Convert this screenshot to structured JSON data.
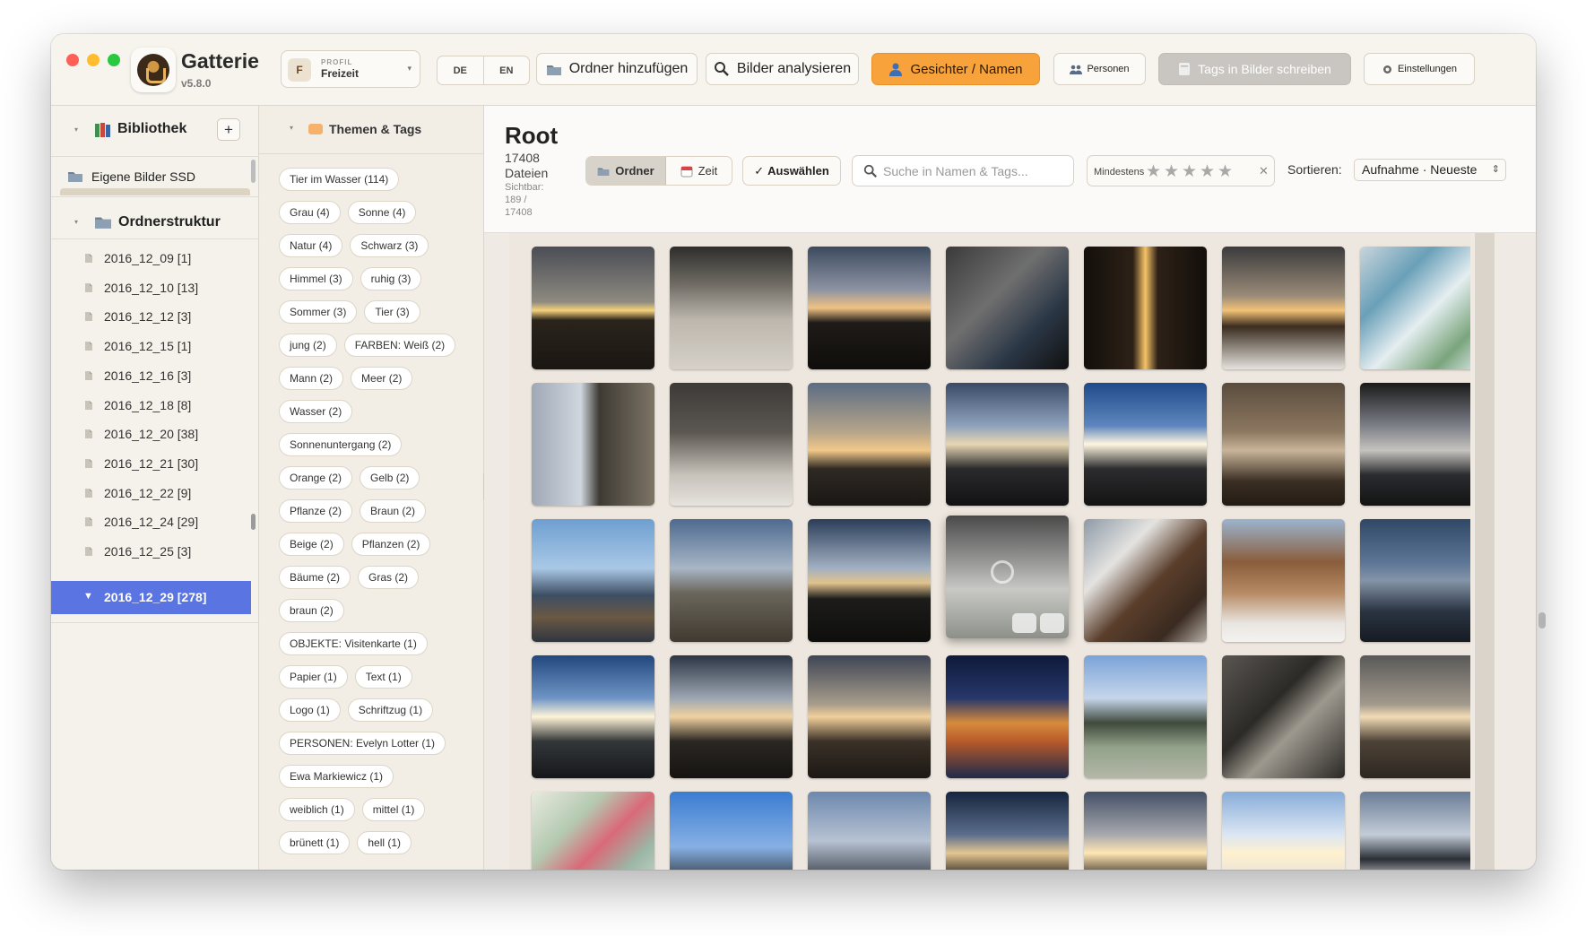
{
  "app": {
    "name": "Gatterie",
    "version": "v5.8.0"
  },
  "profile": {
    "label": "PROFIL",
    "value": "Freizeit",
    "initial": "F"
  },
  "languages": [
    "DE",
    "EN"
  ],
  "toolbar": {
    "add_folder": "Ordner hinzufügen",
    "analyze": "Bilder analysieren",
    "faces": "Gesichter / Namen",
    "persons": "Personen",
    "write_tags": "Tags in Bilder schreiben",
    "settings": "Einstellungen"
  },
  "sidebar": {
    "library_title": "Bibliothek",
    "add_label": "+",
    "library_item": "Eigene Bilder SSD",
    "structure_title": "Ordnerstruktur",
    "folders": [
      "2016_12_09 [1]",
      "2016_12_10 [13]",
      "2016_12_12 [3]",
      "2016_12_15 [1]",
      "2016_12_16 [3]",
      "2016_12_18 [8]",
      "2016_12_20 [38]",
      "2016_12_21 [30]",
      "2016_12_22 [9]",
      "2016_12_24 [29]",
      "2016_12_25 [3]"
    ],
    "selected_folder": "2016_12_29 [278]"
  },
  "tags_panel": {
    "title": "Themen & Tags",
    "tags": [
      "Tier im Wasser (114)",
      "Grau (4)",
      "Sonne (4)",
      "Natur (4)",
      "Schwarz (3)",
      "Himmel (3)",
      "ruhig (3)",
      "Sommer (3)",
      "Tier (3)",
      "jung (2)",
      "FARBEN: Weiß (2)",
      "Mann (2)",
      "Meer (2)",
      "Wasser (2)",
      "Sonnenuntergang (2)",
      "Orange (2)",
      "Gelb (2)",
      "Pflanze (2)",
      "Braun (2)",
      "Beige (2)",
      "Pflanzen (2)",
      "Bäume (2)",
      "Gras (2)",
      "braun (2)",
      "OBJEKTE: Visitenkarte (1)",
      "Papier (1)",
      "Text (1)",
      "Logo (1)",
      "Schriftzug (1)",
      "PERSONEN: Evelyn Lotter (1)",
      "Ewa Markiewicz (1)",
      "weiblich (1)",
      "mittel (1)",
      "brünett (1)",
      "hell (1)"
    ]
  },
  "main": {
    "title": "Root",
    "count_line1": "17408",
    "count_line2": "Dateien",
    "visible_line1": "Sichtbar:",
    "visible_line2": "189 /",
    "visible_line3": "17408",
    "view_folder": "Ordner",
    "view_time": "Zeit",
    "select_label": "Auswählen",
    "search_placeholder": "Suche in Namen & Tags...",
    "min_label": "Mindestens",
    "sort_label": "Sortieren:",
    "sort_value": "Aufnahme · Neueste"
  },
  "thumbnails": [
    "sunset-through-trees",
    "snowy-path",
    "sunset-branches",
    "tree-shadow-ground",
    "sun-behind-trunk",
    "sunset-over-valley",
    "hiking-map",
    "sideways-tree",
    "bare-forest-snow",
    "sunset-clouds",
    "valley-sunset",
    "sun-low-sky",
    "hazy-valley",
    "tree-silhouette",
    "person-at-lookout",
    "valley-haze",
    "tree-at-dusk",
    "foggy-meadow",
    "wooden-shed",
    "forest-snow",
    "dusk-valley",
    "sun-clouds",
    "branches-sunset",
    "sunset-glare",
    "coastal-village-night",
    "green-hillside",
    "rocky-close-up",
    "sun-haze",
    "topographic-map",
    "cloud-horizon",
    "twilight-sky",
    "tree-sunset",
    "sun-through-branches",
    "bright-sky",
    "dark-clouds"
  ],
  "colors": {
    "accent": "#5a74e2",
    "orange": "#f7a23a",
    "disabled": "#c9c6c1"
  }
}
